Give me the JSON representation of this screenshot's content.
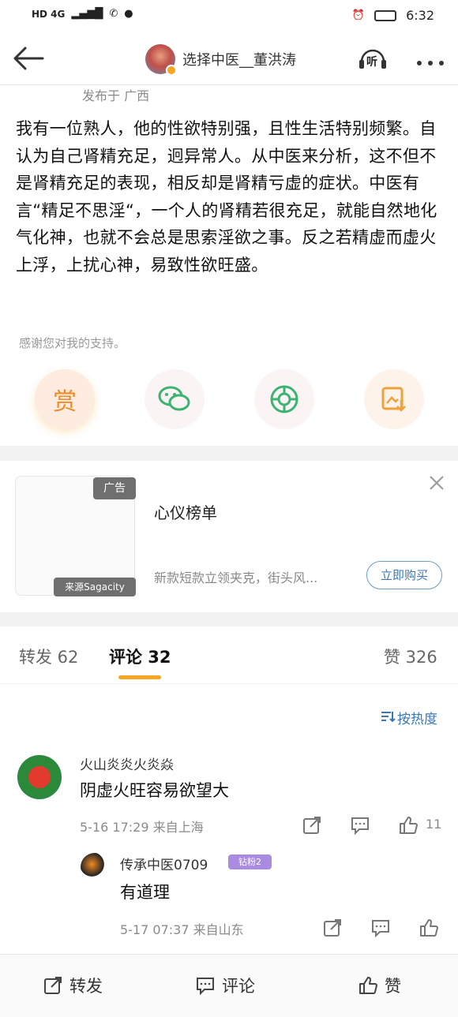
{
  "status_bar": {
    "left": "HD 4G",
    "time": "6:32"
  },
  "header": {
    "title": "选择中医__董洪涛",
    "listen_icon": "听"
  },
  "post": {
    "location": "发布于 广西",
    "body": "我有一位熟人，他的性欲特别强，且性生活特别频繁。自认为自己肾精充足，迥异常人。从中医来分析，这不但不是肾精充足的表现，相反却是肾精亏虚的症状。中医有言“精足不思淫“，一个人的肾精若很充足，就能自然地化气化神，也就不会总是思索淫欲之事。反之若精虚而虚火上浮，上扰心神，易致性欲旺盛。",
    "thanks": "感谢您对我的支持。",
    "reward_label": "赏"
  },
  "ad": {
    "tag": "广告",
    "source": "来源Sagacity",
    "title": "心仪榜单",
    "desc": "新款短款立领夹克，街头风...",
    "buy_label": "立即购买"
  },
  "tabs": {
    "repost": "转发 62",
    "comment": "评论 32",
    "like": "赞 326"
  },
  "sort_label": "按热度",
  "comments": [
    {
      "user": "火山炎炎火炎焱",
      "text": "阴虚火旺容易欲望大",
      "meta": "5-16 17:29 来自上海",
      "likes": "11"
    }
  ],
  "reply": {
    "user": "传承中医0709",
    "badge": "钻粉2",
    "text": "有道理",
    "meta": "5-17 07:37 来自山东"
  },
  "bottom_bar": {
    "repost": "转发",
    "comment": "评论",
    "like": "赞"
  },
  "colors": {
    "accent": "#f5a623",
    "link": "#3a78b5",
    "wechat": "#3cb371"
  }
}
